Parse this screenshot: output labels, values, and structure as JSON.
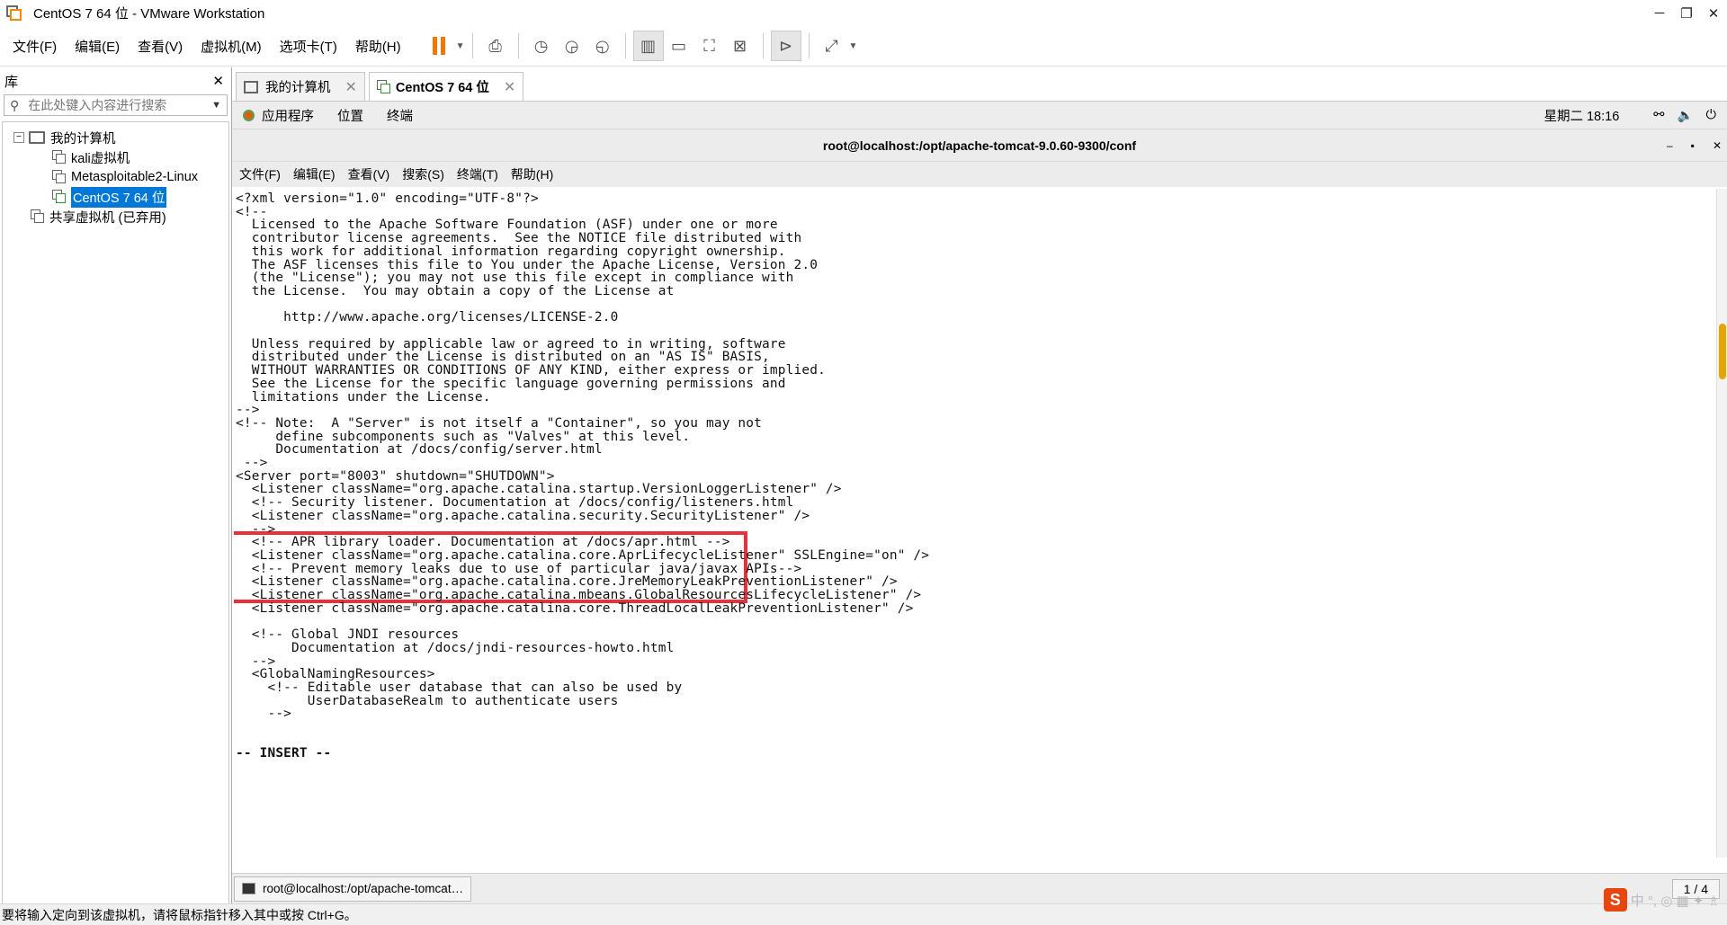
{
  "window": {
    "title": "CentOS 7 64 位 - VMware Workstation",
    "minimize": "─",
    "maximize": "❐",
    "close": "✕"
  },
  "menu": [
    "文件(F)",
    "编辑(E)",
    "查看(V)",
    "虚拟机(M)",
    "选项卡(T)",
    "帮助(H)"
  ],
  "library": {
    "title": "库",
    "close": "✕",
    "search_placeholder": "在此处键入内容进行搜索",
    "tree": {
      "root": "我的计算机",
      "expander": "⊟",
      "vms": [
        "kali虚拟机",
        "Metasploitable2-Linux",
        "CentOS 7 64 位"
      ],
      "shared": "共享虚拟机 (已弃用)"
    }
  },
  "tabs": [
    {
      "label": "我的计算机",
      "close": "✕"
    },
    {
      "label": "CentOS 7 64 位",
      "close": "✕"
    }
  ],
  "gnome": {
    "menus": [
      "应用程序",
      "位置",
      "终端"
    ],
    "clock": "星期二 18:16"
  },
  "terminal": {
    "title": "root@localhost:/opt/apache-tomcat-9.0.60-9300/conf",
    "controls": [
      "‒",
      "▪",
      "✕"
    ],
    "menu": [
      "文件(F)",
      "编辑(E)",
      "查看(V)",
      "搜索(S)",
      "终端(T)",
      "帮助(H)"
    ],
    "lines": [
      "<?xml version=\"1.0\" encoding=\"UTF-8\"?>",
      "<!--",
      "  Licensed to the Apache Software Foundation (ASF) under one or more",
      "  contributor license agreements.  See the NOTICE file distributed with",
      "  this work for additional information regarding copyright ownership.",
      "  The ASF licenses this file to You under the Apache License, Version 2.0",
      "  (the \"License\"); you may not use this file except in compliance with",
      "  the License.  You may obtain a copy of the License at",
      "",
      "      http://www.apache.org/licenses/LICENSE-2.0",
      "",
      "  Unless required by applicable law or agreed to in writing, software",
      "  distributed under the License is distributed on an \"AS IS\" BASIS,",
      "  WITHOUT WARRANTIES OR CONDITIONS OF ANY KIND, either express or implied.",
      "  See the License for the specific language governing permissions and",
      "  limitations under the License.",
      "-->",
      "<!-- Note:  A \"Server\" is not itself a \"Container\", so you may not",
      "     define subcomponents such as \"Valves\" at this level.",
      "     Documentation at /docs/config/server.html",
      " -->",
      "<Server port=\"8003\" shutdown=\"SHUTDOWN\">",
      "  <Listener className=\"org.apache.catalina.startup.VersionLoggerListener\" />",
      "  <!-- Security listener. Documentation at /docs/config/listeners.html",
      "  <Listener className=\"org.apache.catalina.security.SecurityListener\" />",
      "  -->",
      "  <!-- APR library loader. Documentation at /docs/apr.html -->",
      "  <Listener className=\"org.apache.catalina.core.AprLifecycleListener\" SSLEngine=\"on\" />",
      "  <!-- Prevent memory leaks due to use of particular java/javax APIs-->",
      "  <Listener className=\"org.apache.catalina.core.JreMemoryLeakPreventionListener\" />",
      "  <Listener className=\"org.apache.catalina.mbeans.GlobalResourcesLifecycleListener\" />",
      "  <Listener className=\"org.apache.catalina.core.ThreadLocalLeakPreventionListener\" />",
      "",
      "  <!-- Global JNDI resources",
      "       Documentation at /docs/jndi-resources-howto.html",
      "  -->",
      "  <GlobalNamingResources>",
      "    <!-- Editable user database that can also be used by",
      "         UserDatabaseRealm to authenticate users",
      "    -->",
      "-- INSERT --"
    ]
  },
  "taskbar": {
    "item": "root@localhost:/opt/apache-tomcat…",
    "page": "1 / 4"
  },
  "status": "要将输入定向到该虚拟机，请将鼠标指针移入其中或按 Ctrl+G。",
  "tray": {
    "text": "中 °, ◎ ▦ ✦ ♗"
  },
  "colors": {
    "highlight": "#e8313a",
    "selection": "#0078d7",
    "accent": "#f07800"
  }
}
